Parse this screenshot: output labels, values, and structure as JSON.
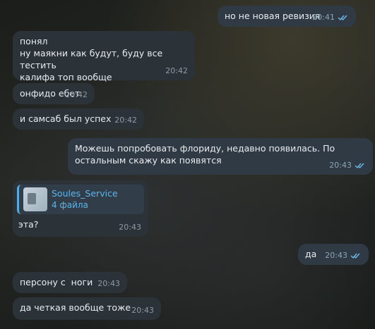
{
  "messages": [
    {
      "dir": "out",
      "text": "но не новая ревизия",
      "time": "20:41",
      "read": true
    },
    {
      "dir": "in",
      "text": "понял\nну маякни как будут, буду все тестить\nкалифа топ вообще",
      "time": "20:42"
    },
    {
      "dir": "in",
      "text": "онфидо ебет",
      "time": "20:42"
    },
    {
      "dir": "in",
      "text": "и самсаб был успех",
      "time": "20:42"
    },
    {
      "dir": "out",
      "text": "Можешь попробовать флориду, недавно появилась. По\nостальным скажу как появятся",
      "time": "20:43",
      "read": true
    },
    {
      "dir": "in",
      "text": "эта?",
      "time": "20:43",
      "forward": {
        "name": "Soules_Service",
        "count": "4 файла"
      }
    },
    {
      "dir": "out",
      "text": "да",
      "time": "20:43",
      "read": true
    },
    {
      "dir": "in",
      "text": "персону с  ноги",
      "time": "20:43"
    },
    {
      "dir": "in",
      "text": "да четкая вообще тоже",
      "time": "20:43"
    }
  ],
  "colors": {
    "incoming": "#2b3339",
    "outgoing": "#2f3a45",
    "check": "#6fb8e6",
    "link": "#5fb4ea"
  }
}
